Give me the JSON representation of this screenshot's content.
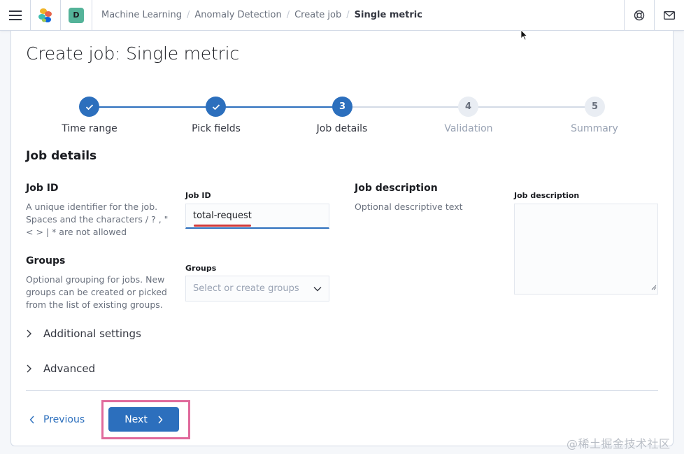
{
  "header": {
    "menu_icon": "hamburger-menu-icon",
    "logo_icon": "elastic-logo-icon",
    "space_badge": "D",
    "breadcrumbs": [
      "Machine Learning",
      "Anomaly Detection",
      "Create job",
      "Single metric"
    ],
    "help_icon": "help-lifebuoy-icon",
    "mail_icon": "mail-icon"
  },
  "page": {
    "title": "Create job: Single metric"
  },
  "steps": [
    {
      "number": "1",
      "label": "Time range",
      "status": "complete"
    },
    {
      "number": "2",
      "label": "Pick fields",
      "status": "complete"
    },
    {
      "number": "3",
      "label": "Job details",
      "status": "current"
    },
    {
      "number": "4",
      "label": "Validation",
      "status": "incomplete"
    },
    {
      "number": "5",
      "label": "Summary",
      "status": "incomplete"
    }
  ],
  "job_details": {
    "section_title": "Job details",
    "job_id": {
      "title": "Job ID",
      "description": "A unique identifier for the job. Spaces and the characters / ? , \" < > | * are not allowed",
      "label": "Job ID",
      "value": "total-request"
    },
    "groups": {
      "title": "Groups",
      "description": "Optional grouping for jobs. New groups can be created or picked from the list of existing groups.",
      "label": "Groups",
      "placeholder": "Select or create groups"
    },
    "job_description": {
      "title": "Job description",
      "description": "Optional descriptive text",
      "label": "Job description",
      "value": ""
    },
    "accordions": [
      "Additional settings",
      "Advanced"
    ]
  },
  "footer": {
    "previous_label": "Previous",
    "next_label": "Next"
  },
  "watermark": "@稀土掘金技术社区",
  "colors": {
    "primary": "#2c6fbd",
    "step_done": "#2c6fbd",
    "step_todo": "#e9edf3",
    "highlight_border": "#e06a9c",
    "annotation_underline": "#d23a3a",
    "space_badge": "#54b399"
  }
}
